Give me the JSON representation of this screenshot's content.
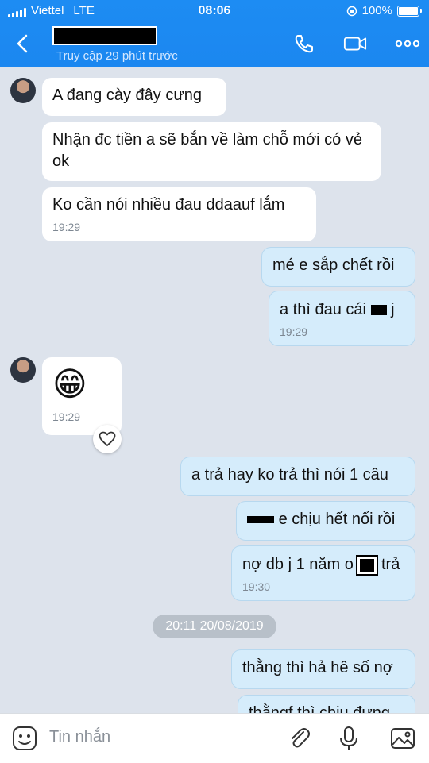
{
  "status_bar": {
    "carrier": "Viettel",
    "network": "LTE",
    "time": "08:06",
    "battery": "100%"
  },
  "header": {
    "subtitle": "Truy cập 29 phút trước"
  },
  "messages": [
    {
      "dir": "in",
      "text": "A đang cày đây cưng"
    },
    {
      "dir": "in",
      "text": "Nhận đc tiền a sẽ bắn về làm chỗ mới có vẻ ok"
    },
    {
      "dir": "in",
      "text": "Ko cần nói nhiều đau ddaauf lắm",
      "time": "19:29"
    },
    {
      "dir": "out",
      "text": "mé e sắp chết rồi"
    },
    {
      "dir": "out",
      "text_before": "a thì đau cái",
      "text_after": "j",
      "time": "19:29"
    },
    {
      "dir": "in",
      "emoji": "😁",
      "time": "19:29"
    },
    {
      "dir": "out",
      "text": "a trả hay ko trả thì nói 1 câu"
    },
    {
      "dir": "out",
      "text_after": "e chịu hết nổi rồi"
    },
    {
      "dir": "out",
      "text_before": "nợ db j 1 năm o",
      "text_after": "trả",
      "time": "19:30"
    },
    {
      "dir": "out",
      "text": "thằng thì hả hê số nợ"
    },
    {
      "dir": "out",
      "text": "thằngf thì chịu đựng"
    }
  ],
  "date_divider": "20:11 20/08/2019",
  "input": {
    "placeholder": "Tin nhắn"
  },
  "icons": {
    "back": "chevron-left-icon",
    "call": "phone-icon",
    "video": "video-camera-icon",
    "more": "more-icon",
    "sticker": "sticker-smile-icon",
    "attach": "paperclip-icon",
    "mic": "microphone-icon",
    "image": "image-icon",
    "reaction": "heart-outline-icon"
  },
  "colors": {
    "header": "#1d8cf3",
    "bubble_out": "#d5ecfb",
    "bubble_in": "#ffffff",
    "chat_bg": "#dde3ec"
  }
}
